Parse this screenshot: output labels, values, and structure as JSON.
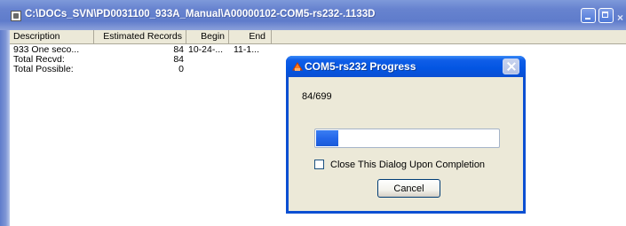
{
  "main_window": {
    "title": "C:\\DOCs_SVN\\PD0031100_933A_Manual\\A00000102-COM5-rs232-.1133D",
    "title_icon": "document-window-icon",
    "controls": {
      "minimize": "minimize-icon",
      "maximize": "maximize-icon",
      "close_partial": "×"
    }
  },
  "list": {
    "columns": [
      "Description",
      "Estimated Records",
      "Begin",
      "End"
    ],
    "rows": [
      {
        "description": "933 One seco...",
        "estimated": "84",
        "begin": "10-24-...",
        "end": "11-1..."
      },
      {
        "description": "Total Recvd:",
        "estimated": "84",
        "begin": "",
        "end": ""
      },
      {
        "description": "Total Possible:",
        "estimated": "0",
        "begin": "",
        "end": ""
      }
    ]
  },
  "dialog": {
    "title": "COM5-rs232 Progress",
    "icon": "app-dialog-icon",
    "count_text": "84/699",
    "progress": {
      "current": 84,
      "total": 699
    },
    "checkbox_label": "Close This Dialog Upon Completion",
    "checkbox_checked": false,
    "cancel_label": "Cancel"
  },
  "colors": {
    "main_titlebar": "#6783cf",
    "dialog_titlebar": "#0355e2",
    "dialog_body": "#ece9d8",
    "progress_fill": "#2467ea"
  }
}
